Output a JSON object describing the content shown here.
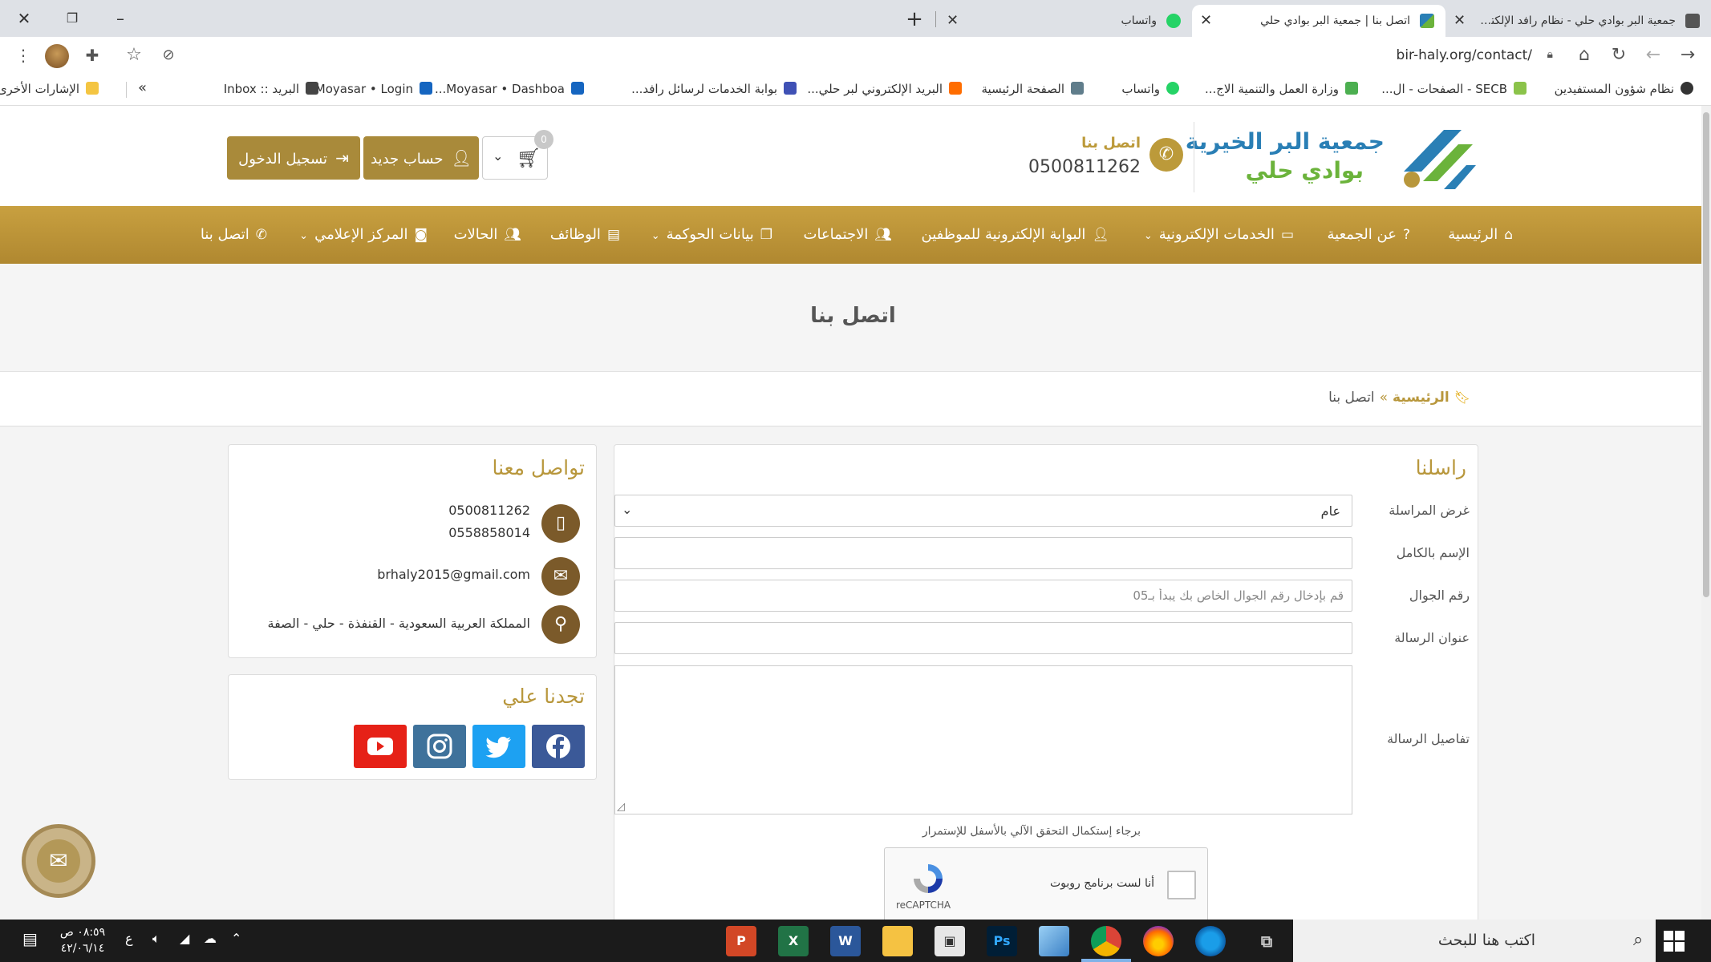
{
  "browser": {
    "tabs": [
      {
        "title": "جمعية البر بوادي حلي - نظام رافد الإلكترون",
        "active": false
      },
      {
        "title": "اتصل بنا | جمعية البر بوادي حلي",
        "active": true
      },
      {
        "title": "واتساب",
        "active": false
      }
    ],
    "url": "bir-haly.org/contact/",
    "bookmarks": [
      "نظام شؤون المستفيدين",
      "SECB - الصفحات - ال...",
      "وزارة العمل والتنمية الاج...",
      "واتساب",
      "الصفحة الرئيسية",
      "البريد الإلكتروني لبر حلي...",
      "بوابة الخدمات لرسائل رافد...",
      "Moyasar • Dashboa...",
      "Moyasar • Login",
      "البريد :: Inbox"
    ],
    "bookmarks_more": "»",
    "other_bookmarks": "الإشارات الأخرى"
  },
  "header": {
    "logo_line1": "جمعية البر الخيرية",
    "logo_line2": "بوادي حلي",
    "call_label": "اتصل بنا",
    "call_number": "0500811262",
    "register_label": "حساب جديد",
    "login_label": "تسجيل الدخول",
    "cart_count": "0"
  },
  "nav": [
    {
      "label": "الرئيسية",
      "icon": "home-icon",
      "dropdown": false
    },
    {
      "label": "عن الجمعية",
      "icon": "question-icon",
      "dropdown": false
    },
    {
      "label": "الخدمات الإلكترونية",
      "icon": "monitor-icon",
      "dropdown": true
    },
    {
      "label": "البوابة الإلكترونية للموظفين",
      "icon": "user-icon",
      "dropdown": false
    },
    {
      "label": "الاجتماعات",
      "icon": "users-icon",
      "dropdown": false
    },
    {
      "label": "بيانات الحوكمة",
      "icon": "copy-icon",
      "dropdown": true
    },
    {
      "label": "الوظائف",
      "icon": "calendar-icon",
      "dropdown": false
    },
    {
      "label": "الحالات",
      "icon": "users-icon",
      "dropdown": false
    },
    {
      "label": "المركز الإعلامي",
      "icon": "camera-icon",
      "dropdown": true
    },
    {
      "label": "اتصل بنا",
      "icon": "phone-icon",
      "dropdown": false
    }
  ],
  "page": {
    "title": "اتصل بنا",
    "breadcrumb_home": "الرئيسية",
    "breadcrumb_sep": "»",
    "breadcrumb_current": "اتصل بنا"
  },
  "form": {
    "title": "راسلنا",
    "purpose_label": "غرض المراسلة",
    "purpose_value": "عام",
    "name_label": "الإسم بالكامل",
    "mobile_label": "رقم الجوال",
    "mobile_placeholder": "قم بإدخال رقم الجوال الخاص بك يبدأ بـ05",
    "subject_label": "عنوان الرسالة",
    "details_label": "تفاصيل الرسالة",
    "captcha_note": "برجاء إستكمال التحقق الآلي بالأسفل للإستمرار",
    "captcha_label": "أنا لست برنامج روبوت",
    "captcha_brand": "reCAPTCHA"
  },
  "contact": {
    "title": "تواصل معنا",
    "phones": [
      "0500811262",
      "0558858014"
    ],
    "email": "brhaly2015@gmail.com",
    "address": "المملكة العربية السعودية - القنفذة - حلي - الصفة"
  },
  "social": {
    "title": "تجدنا علي",
    "links": [
      {
        "name": "facebook",
        "color": "#3b5998"
      },
      {
        "name": "twitter",
        "color": "#1da1f2"
      },
      {
        "name": "instagram",
        "color": "#3f729b"
      },
      {
        "name": "youtube",
        "color": "#e62117"
      }
    ]
  },
  "taskbar": {
    "search_placeholder": "اكتب هنا للبحث",
    "time": "٠٨:٥٩ ص",
    "date": "٤٢/٠٦/١٤",
    "lang": "ع"
  },
  "colors": {
    "brand_gold": "#b8973c",
    "nav_gold": "#bc9a3a",
    "icon_brown": "#7b5a2a"
  }
}
